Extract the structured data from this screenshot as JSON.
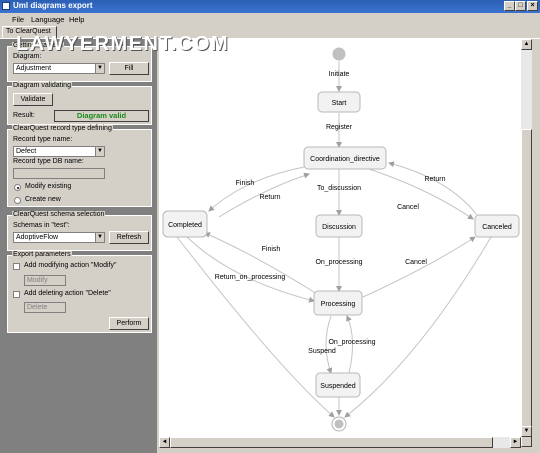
{
  "window": {
    "title": "Uml diagrams export"
  },
  "menu": {
    "file": "File",
    "language": "Language",
    "help": "Help"
  },
  "tab": "To ClearQuest",
  "watermark": "LAWYERMENT.COM",
  "getting_diagram": {
    "legend": "Getting diagram",
    "diagram_label": "Diagram:",
    "diagram_value": "Adjustment",
    "fill_label": "Fill"
  },
  "validating": {
    "legend": "Diagram validating",
    "validate_label": "Validate",
    "result_label": "Result:",
    "result_value": "Diagram valid"
  },
  "record_type": {
    "legend": "ClearQuest record type defining",
    "name_label": "Record type name:",
    "name_value": "Defect",
    "db_label": "Record type DB name:",
    "db_value": "",
    "modify_label": "Modify existing",
    "create_label": "Create new"
  },
  "schema": {
    "legend": "ClearQuest schema selection",
    "schemas_label": "Schemas in \"test\":",
    "schema_value": "AdoptiveFlow",
    "refresh_label": "Refresh"
  },
  "export": {
    "legend": "Export parameters",
    "modify_action_label": "Add modifying action \"Modify\"",
    "modify_field": "Modify",
    "delete_action_label": "Add deleting action \"Delete\"",
    "delete_field": "Delete",
    "perform_label": "Perform"
  },
  "diagram": {
    "states": {
      "start": "Start",
      "coordination": "Coordination_directive",
      "completed": "Completed",
      "discussion": "Discussion",
      "canceled": "Canceled",
      "processing": "Processing",
      "suspended": "Suspended"
    },
    "transitions": {
      "initiate": "Initiate",
      "register": "Register",
      "finish1": "Finish",
      "return1": "Return",
      "to_discussion": "To_discussion",
      "return2": "Return",
      "cancel1": "Cancel",
      "finish2": "Finish",
      "on_processing1": "On_processing",
      "cancel2": "Cancel",
      "return_on_processing": "Return_on_processing",
      "on_processing2": "On_processing",
      "suspend": "Suspend"
    }
  }
}
